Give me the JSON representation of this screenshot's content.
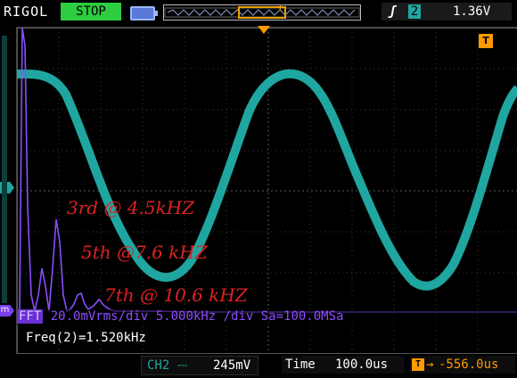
{
  "header": {
    "brand": "RIGOL",
    "run_state": "STOP",
    "trigger_marker": "T",
    "trigger_source": "2",
    "trigger_level": "1.36V"
  },
  "markers": {
    "ch2_marker": "2",
    "math_marker": "m",
    "trigger_level_marker": "T"
  },
  "annotations": {
    "third": "3rd @ 4.5kHZ",
    "fifth": "5th @7.6 kHZ",
    "seventh": "7th @ 10.6 kHZ"
  },
  "fft": {
    "tag": "FFT",
    "info": "20.0mVrms/div 5.000kHz /div Sa=100.0MSa"
  },
  "measurement": {
    "text": "Freq(2)=1.520kHz"
  },
  "footer": {
    "channel_label": "CH2",
    "channel_scale": "245mV",
    "time_label": "Time",
    "time_scale": "100.0us",
    "trigger_offset": "-556.0us"
  },
  "colors": {
    "ch2_wave": "#1fa6a0",
    "fft_trace": "#8a4dff",
    "annotation": "#dd2222",
    "run_state_bg": "#2ecc40",
    "trigger_accent": "#ff9a00"
  },
  "chart_data": {
    "type": "line",
    "series": [
      {
        "name": "CH2",
        "x_us": [
          0,
          50,
          100,
          150,
          200,
          250,
          300,
          350,
          400,
          450,
          500,
          550,
          600,
          650,
          700,
          750,
          800,
          850,
          900,
          950,
          1000,
          1050,
          1100,
          1150,
          1200
        ],
        "y_div": [
          2.8,
          2.7,
          1.9,
          0.6,
          -0.8,
          -1.9,
          -2.5,
          -2.3,
          -1.5,
          -0.2,
          1.2,
          2.3,
          2.8,
          2.6,
          1.8,
          0.4,
          -1.0,
          -2.1,
          -2.7,
          -2.6,
          -1.8,
          -0.5,
          0.9,
          2.0,
          2.6
        ]
      },
      {
        "name": "FFT",
        "freq_khz": [
          0,
          1.52,
          3,
          4.5,
          6,
          7.6,
          9,
          10.6,
          12,
          15,
          20,
          30,
          40,
          50
        ],
        "level_div": [
          0.0,
          5.2,
          0.3,
          2.0,
          0.2,
          0.35,
          0.1,
          0.2,
          0.05,
          0.05,
          0.04,
          0.03,
          0.03,
          0.03
        ]
      }
    ],
    "grid": true
  }
}
